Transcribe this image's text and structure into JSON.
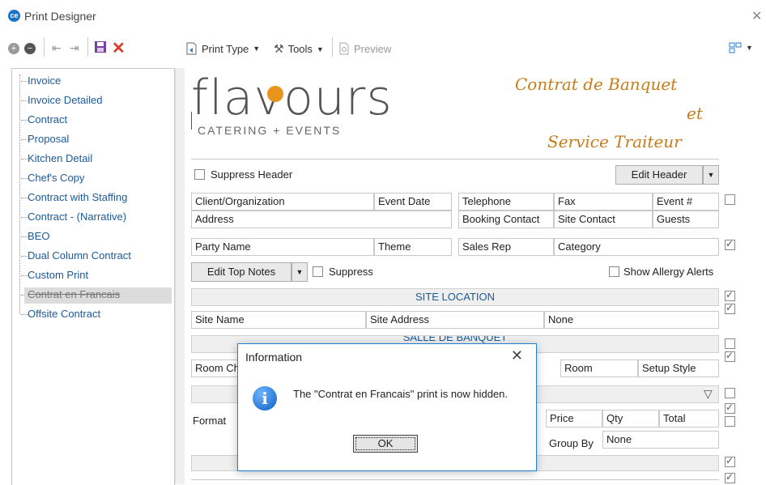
{
  "window": {
    "title": "Print Designer",
    "app_icon": "ce"
  },
  "toolbar": {
    "print_type": "Print Type",
    "tools": "Tools",
    "preview": "Preview"
  },
  "tree": {
    "items": [
      {
        "label": "Invoice"
      },
      {
        "label": "Invoice Detailed"
      },
      {
        "label": "Contract"
      },
      {
        "label": "Proposal"
      },
      {
        "label": "Kitchen Detail"
      },
      {
        "label": "Chef's Copy"
      },
      {
        "label": "Contract with Staffing"
      },
      {
        "label": "Contract - (Narrative)"
      },
      {
        "label": "BEO"
      },
      {
        "label": "Dual Column Contract"
      },
      {
        "label": "Custom Print"
      },
      {
        "label": "Contrat en Francais"
      },
      {
        "label": "Offsite Contract"
      }
    ]
  },
  "logo": {
    "word": "flavours",
    "tagline": "CATERING + EVENTS"
  },
  "heading": {
    "line1": "Contrat de Banquet",
    "line2": "et",
    "line3": "Service Traiteur"
  },
  "colors": {
    "accent": "#c77c1a",
    "link": "#1b5a9a",
    "dialog_border": "#1e7fd4"
  },
  "form": {
    "suppress_header": "Suppress Header",
    "edit_header": "Edit Header",
    "row1": [
      "Client/Organization",
      "Event Date",
      "Telephone",
      "Fax",
      "Event #"
    ],
    "row2": [
      "Address",
      "Booking Contact",
      "Site Contact",
      "Guests"
    ],
    "row3": [
      "Party Name",
      "Theme",
      "Sales Rep",
      "Category"
    ],
    "edit_top_notes": "Edit Top Notes",
    "suppress": "Suppress",
    "show_allergy": "Show Allergy Alerts",
    "site_location": "SITE LOCATION",
    "site_row": [
      "Site Name",
      "Site Address",
      "None"
    ],
    "salle": "SALLE DE BANQUET",
    "room_row": [
      "Room Ch",
      "Room",
      "Setup Style"
    ],
    "format": "Format",
    "price_row": [
      "Price",
      "Qty",
      "Total"
    ],
    "group_by": "Group By",
    "group_by_value": "None"
  },
  "dialog": {
    "title": "Information",
    "message": "The \"Contrat en Francais\" print is now hidden.",
    "ok": "OK"
  }
}
